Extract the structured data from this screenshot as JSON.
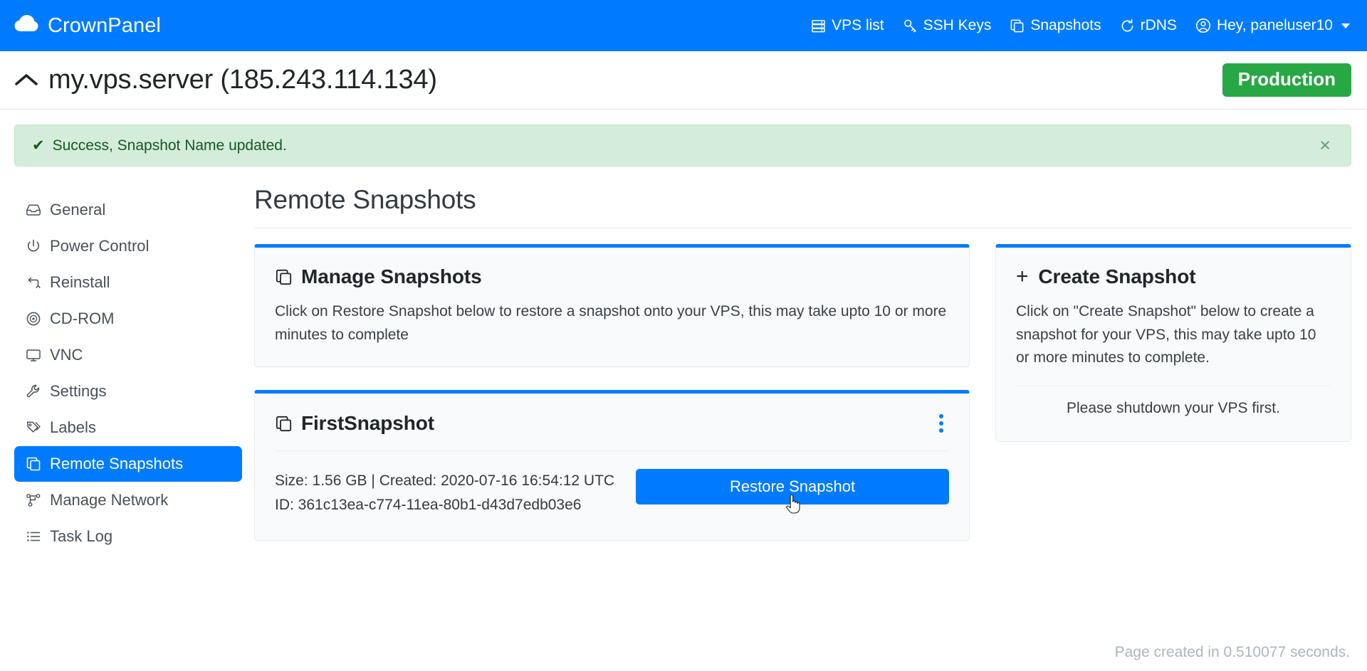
{
  "navbar": {
    "brand": "CrownPanel",
    "brand_icon": "cloud-icon",
    "links": [
      {
        "label": "VPS list",
        "icon": "server-list-icon"
      },
      {
        "label": "SSH Keys",
        "icon": "key-icon"
      },
      {
        "label": "Snapshots",
        "icon": "copy-icon"
      },
      {
        "label": "rDNS",
        "icon": "refresh-icon"
      },
      {
        "label": "Hey, paneluser10",
        "icon": "user-circle-icon"
      }
    ]
  },
  "titlebar": {
    "collapse_icon": "chevron-up-icon",
    "host": "my.vps.server (185.243.114.134)",
    "env_badge": "Production"
  },
  "alert": {
    "icon": "check-icon",
    "message": "Success, Snapshot Name updated.",
    "close_icon": "close-icon",
    "close_label": "×",
    "bg_color": "#d4edda",
    "text_color": "#155724"
  },
  "sidebar": {
    "items": [
      {
        "label": "General",
        "icon": "inbox-icon",
        "active": false
      },
      {
        "label": "Power Control",
        "icon": "power-icon",
        "active": false
      },
      {
        "label": "Reinstall",
        "icon": "reinstall-icon",
        "active": false
      },
      {
        "label": "CD-ROM",
        "icon": "disc-icon",
        "active": false
      },
      {
        "label": "VNC",
        "icon": "monitor-icon",
        "active": false
      },
      {
        "label": "Settings",
        "icon": "wrench-icon",
        "active": false
      },
      {
        "label": "Labels",
        "icon": "tag-icon",
        "active": false
      },
      {
        "label": "Remote Snapshots",
        "icon": "copy-icon",
        "active": true
      },
      {
        "label": "Manage Network",
        "icon": "network-icon",
        "active": false
      },
      {
        "label": "Task Log",
        "icon": "list-icon",
        "active": false
      }
    ]
  },
  "main": {
    "title": "Remote Snapshots",
    "manage_card": {
      "icon": "copy-icon",
      "title": "Manage Snapshots",
      "text": "Click on Restore Snapshot below to restore a snapshot onto your VPS, this may take upto 10 or more minutes to complete"
    },
    "snapshot": {
      "icon": "copy-icon",
      "name": "FirstSnapshot",
      "menu_icon": "kebab-menu-icon",
      "size_line": "Size: 1.56 GB | Created: 2020-07-16 16:54:12 UTC",
      "id_line": "ID: 361c13ea-c774-11ea-80b1-d43d7edb03e6",
      "restore_label": "Restore Snapshot"
    },
    "create_card": {
      "plus": "+",
      "title": "Create Snapshot",
      "text": "Click on \"Create Snapshot\" below to create a snapshot for your VPS, this may take upto 10 or more minutes to complete.",
      "note": "Please shutdown your VPS first."
    }
  },
  "footer": {
    "text": "Page created in 0.510077 seconds."
  },
  "colors": {
    "primary": "#007bff",
    "success": "#28a745",
    "alert_bg": "#d4edda",
    "card_bg": "#f9fafb"
  }
}
